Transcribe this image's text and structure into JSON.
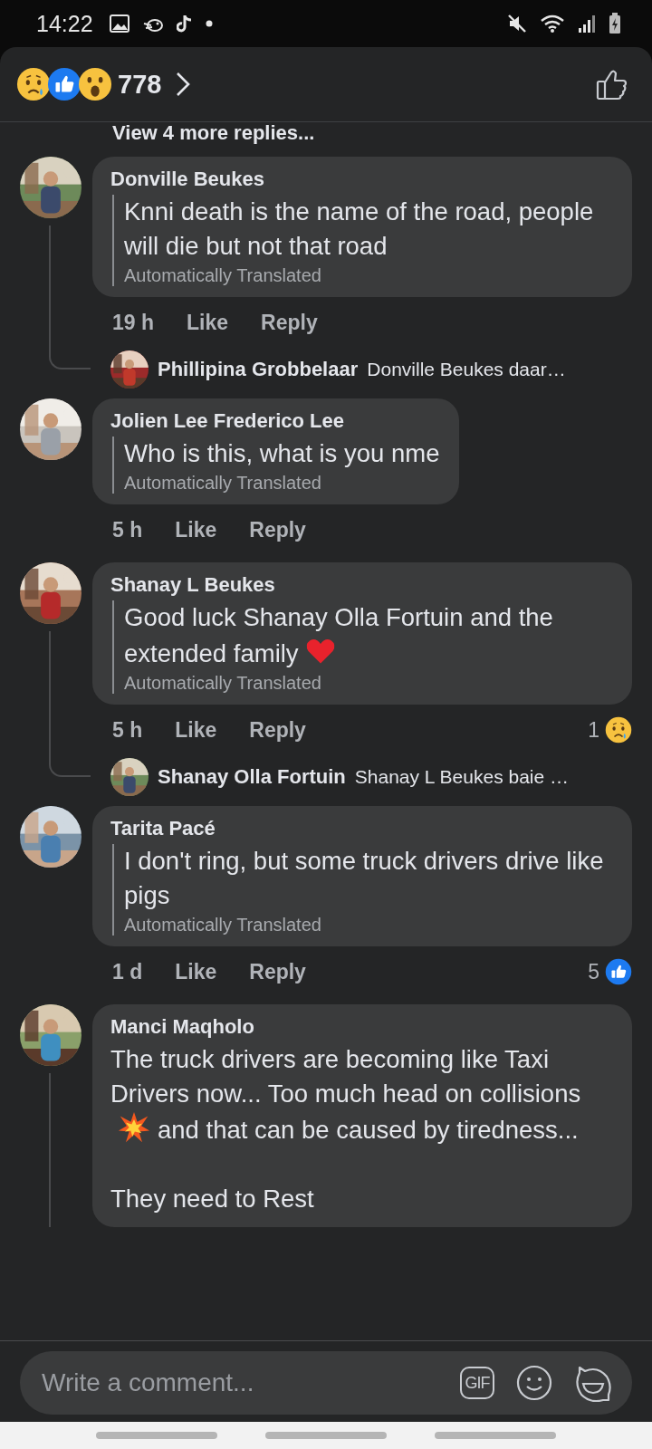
{
  "status_bar": {
    "time": "14:22"
  },
  "header": {
    "reactions": [
      {
        "kind": "sad"
      },
      {
        "kind": "like"
      },
      {
        "kind": "wow"
      }
    ],
    "count": "778"
  },
  "view_more": "View 4 more replies...",
  "comments": [
    {
      "author": "Donville Beukes",
      "paragraphs": [
        [
          {
            "kind": "text",
            "text": "Knni death is the name of the road, people will die but not that road"
          }
        ]
      ],
      "translated": "Automatically Translated",
      "time": "19 h",
      "like": "Like",
      "reply": "Reply",
      "thread": true,
      "reply_preview": {
        "author": "Phillipina Grobbelaar",
        "text": "Donville Beukes daar…"
      }
    },
    {
      "author": "Jolien Lee Frederico Lee",
      "paragraphs": [
        [
          {
            "kind": "text",
            "text": "Who is this, what is you nme"
          }
        ]
      ],
      "translated": "Automatically Translated",
      "time": "5 h",
      "like": "Like",
      "reply": "Reply",
      "thread": false
    },
    {
      "author": "Shanay L Beukes",
      "paragraphs": [
        [
          {
            "kind": "text",
            "text": "Good luck Shanay Olla Fortuin and the extended family"
          },
          {
            "kind": "heart"
          }
        ]
      ],
      "translated": "Automatically Translated",
      "time": "5 h",
      "like": "Like",
      "reply": "Reply",
      "reaction_count": {
        "count": "1",
        "kind": "sad"
      },
      "thread": true,
      "reply_preview": {
        "author": "Shanay Olla Fortuin",
        "text": "Shanay L Beukes baie …"
      }
    },
    {
      "author": "Tarita Pacé",
      "paragraphs": [
        [
          {
            "kind": "text",
            "text": "I don't ring, but some truck drivers drive like pigs"
          }
        ]
      ],
      "translated": "Automatically Translated",
      "time": "1 d",
      "like": "Like",
      "reply": "Reply",
      "reaction_count": {
        "count": "5",
        "kind": "like"
      },
      "thread": false
    },
    {
      "author": "Manci Maqholo",
      "paragraphs": [
        [
          {
            "kind": "text",
            "text": "The truck drivers are becoming like Taxi Drivers now... Too much head on collisions"
          },
          {
            "kind": "collision"
          },
          {
            "kind": "text",
            "text": "and that can be caused by tiredness..."
          }
        ],
        [
          {
            "kind": "text",
            "text": "They need to Rest"
          }
        ]
      ],
      "thread": true
    }
  ],
  "composer": {
    "placeholder": "Write a comment...",
    "gif_label": "GIF"
  }
}
